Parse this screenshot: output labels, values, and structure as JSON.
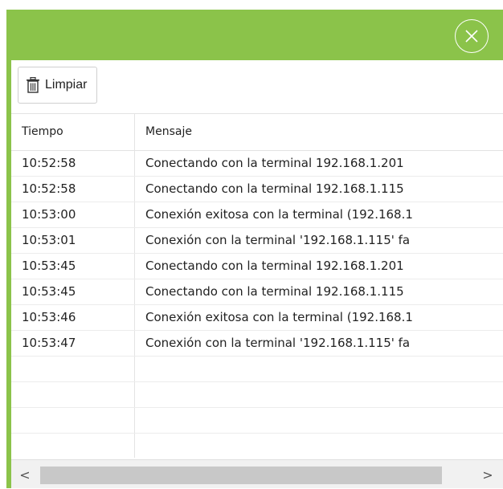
{
  "toolbar": {
    "clear_label": "Limpiar",
    "clear_icon": "trash-icon"
  },
  "titlebar": {
    "color": "#8bc34a",
    "close_icon": "close-icon"
  },
  "grid": {
    "columns": [
      "Tiempo",
      "Mensaje"
    ],
    "rows": [
      [
        "10:52:58",
        "Conectando con la terminal 192.168.1.201"
      ],
      [
        "10:52:58",
        "Conectando con la terminal 192.168.1.115"
      ],
      [
        "10:53:00",
        "Conexión exitosa con la terminal (192.168.1"
      ],
      [
        "10:53:01",
        "Conexión con la terminal '192.168.1.115' fa"
      ],
      [
        "10:53:45",
        "Conectando con la terminal 192.168.1.201"
      ],
      [
        "10:53:45",
        "Conectando con la terminal 192.168.1.115"
      ],
      [
        "10:53:46",
        "Conexión exitosa con la terminal (192.168.1"
      ],
      [
        "10:53:47",
        "Conexión con la terminal '192.168.1.115' fa"
      ]
    ]
  },
  "scrollbar": {
    "left_arrow": "<",
    "right_arrow": ">"
  }
}
